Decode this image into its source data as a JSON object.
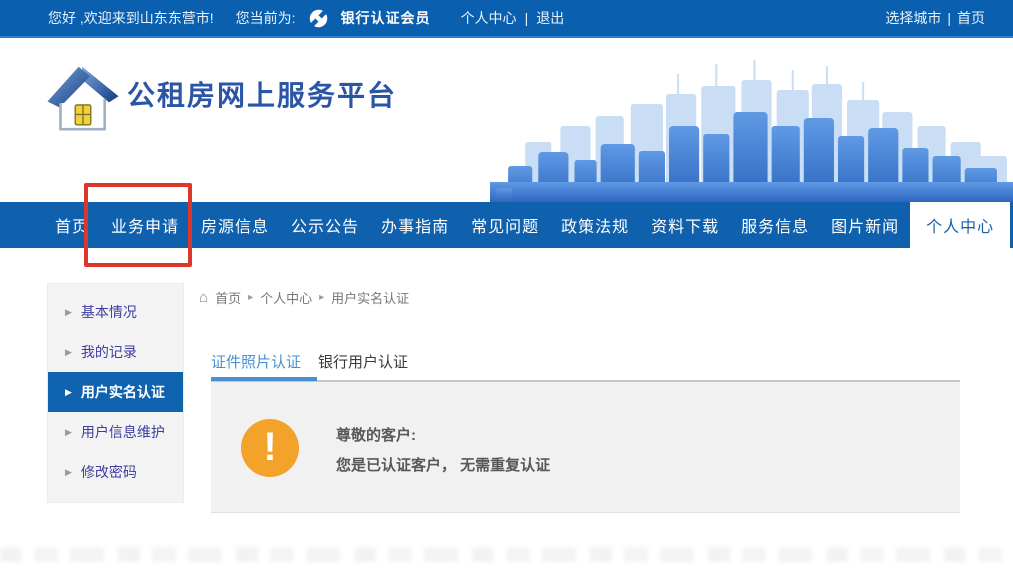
{
  "topbar": {
    "greeting": "您好 ,欢迎来到山东东营市!",
    "current_prefix": "您当前为:",
    "member_badge": "银行认证会员",
    "personal_center": "个人中心",
    "separator": "|",
    "logout": "退出",
    "city_select": "选择城市",
    "city_separator": "|",
    "home": "首页"
  },
  "header": {
    "site_title": "公租房网上服务平台"
  },
  "nav": {
    "items": [
      "首页",
      "业务申请",
      "房源信息",
      "公示公告",
      "办事指南",
      "常见问题",
      "政策法规",
      "资料下载",
      "服务信息",
      "图片新闻",
      "个人中心"
    ],
    "active_item": "个人中心",
    "annotated_item": "业务申请"
  },
  "breadcrumb": {
    "home": "首页",
    "level2": "个人中心",
    "level3": "用户实名认证"
  },
  "sidebar": {
    "items": [
      {
        "label": "基本情况",
        "active": false
      },
      {
        "label": "我的记录",
        "active": false
      },
      {
        "label": "用户实名认证",
        "active": true
      },
      {
        "label": "用户信息维护",
        "active": false
      },
      {
        "label": "修改密码",
        "active": false
      }
    ]
  },
  "tabs": {
    "items": [
      {
        "label": "证件照片认证",
        "active": true
      },
      {
        "label": "银行用户认证",
        "active": false
      }
    ]
  },
  "notice": {
    "salutation": "尊敬的客户:",
    "message": "您是已认证客户， 无需重复认证",
    "icon": "exclamation-icon"
  },
  "colors": {
    "topbar_blue": "#0a5fae",
    "nav_blue": "#1061ad",
    "title_blue": "#2b55a7",
    "annotation_red": "#dd372c",
    "active_tab_blue": "#4a8fd2",
    "sidebar_link_blue": "#3d3da2",
    "sidebar_active_bg": "#0f62ae",
    "notice_orange": "#f3a329"
  }
}
